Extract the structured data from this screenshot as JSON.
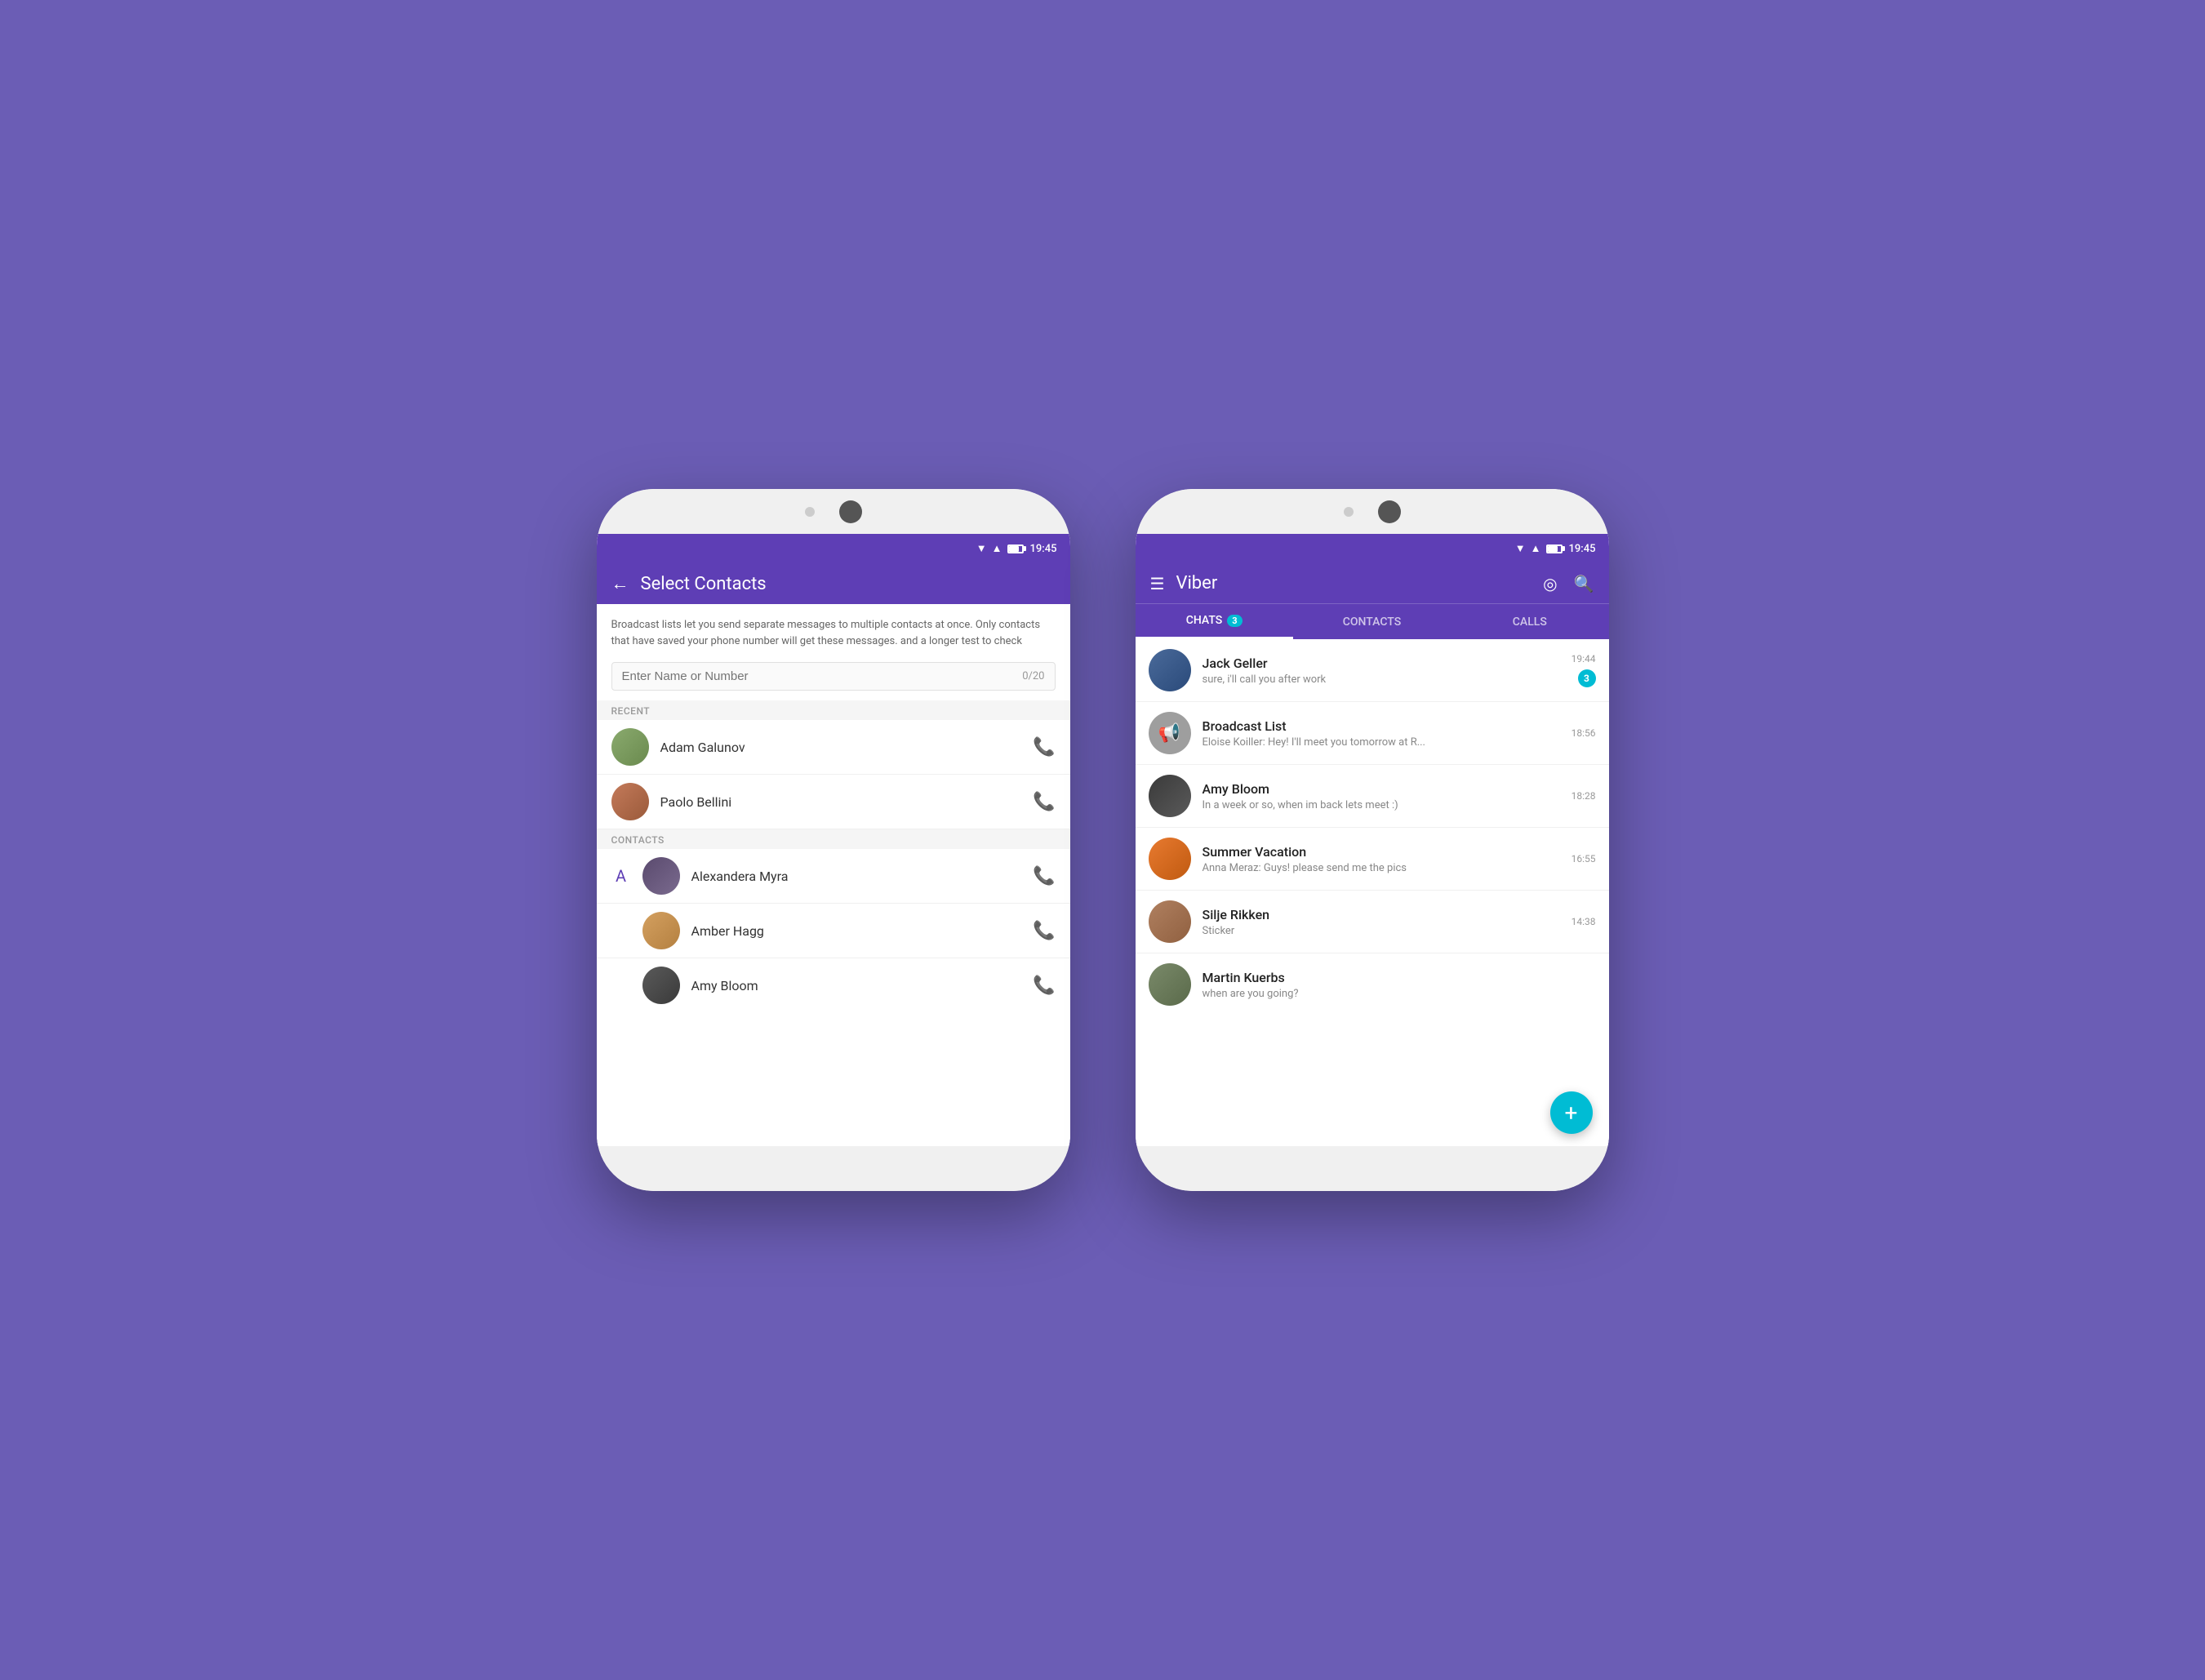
{
  "background_color": "#6b5db5",
  "phone1": {
    "status_bar": {
      "time": "19:45"
    },
    "header": {
      "back_label": "←",
      "title": "Select Contacts"
    },
    "broadcast_text": "Broadcast lists let you send separate messages to multiple contacts at once. Only contacts that have saved your phone number will get these messages. and a longer test to check",
    "search": {
      "placeholder": "Enter Name or Number",
      "count": "0/20"
    },
    "recent_label": "RECENT",
    "recent_contacts": [
      {
        "name": "Adam Galunov",
        "avatar_class": "av-adam"
      },
      {
        "name": "Paolo Bellini",
        "avatar_class": "av-paolo"
      }
    ],
    "contacts_label": "CONTACTS",
    "alphabet_letter": "A",
    "contacts": [
      {
        "name": "Alexandera Myra",
        "avatar_class": "av-alex"
      },
      {
        "name": "Amber Hagg",
        "avatar_class": "av-amber"
      },
      {
        "name": "Amy Bloom",
        "avatar_class": "av-amy"
      }
    ]
  },
  "phone2": {
    "status_bar": {
      "time": "19:45"
    },
    "header": {
      "app_name": "Viber"
    },
    "tabs": [
      {
        "label": "CHATS",
        "badge": "3",
        "active": true
      },
      {
        "label": "CONTACTS",
        "badge": null,
        "active": false
      },
      {
        "label": "CALLS",
        "badge": null,
        "active": false
      }
    ],
    "chats": [
      {
        "name": "Jack Geller",
        "preview": "sure, i'll call you after work",
        "time": "19:44",
        "unread": "3",
        "avatar_class": "av-jack",
        "avatar_text": ""
      },
      {
        "name": "Broadcast List",
        "preview": "Eloise Koiller: Hey! I'll meet you tomorrow at R...",
        "time": "18:56",
        "unread": null,
        "avatar_class": "av-broadcast",
        "avatar_text": "📢"
      },
      {
        "name": "Amy Bloom",
        "preview": "In a week or so, when im back lets meet :)",
        "time": "18:28",
        "unread": null,
        "avatar_class": "av-amy2",
        "avatar_text": ""
      },
      {
        "name": "Summer Vacation",
        "preview": "Anna Meraz: Guys! please send me the pics",
        "time": "16:55",
        "unread": null,
        "avatar_class": "av-summer",
        "avatar_text": ""
      },
      {
        "name": "Silje Rikken",
        "preview": "Sticker",
        "time": "14:38",
        "unread": null,
        "avatar_class": "av-silje",
        "avatar_text": ""
      },
      {
        "name": "Martin Kuerbs",
        "preview": "when are you going?",
        "time": null,
        "unread": null,
        "avatar_class": "av-martin",
        "avatar_text": ""
      }
    ],
    "fab_label": "+"
  }
}
